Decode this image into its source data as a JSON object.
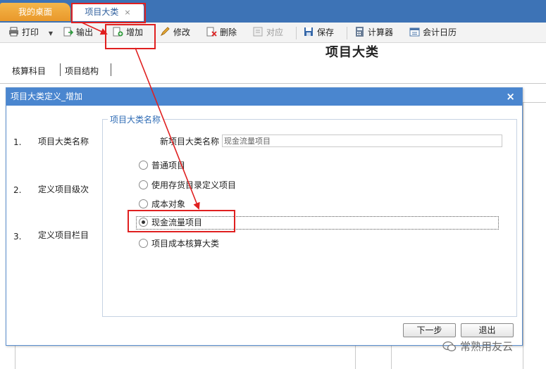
{
  "tabs": {
    "home": "我的桌面",
    "active": "项目大类",
    "close": "×"
  },
  "toolbar": {
    "print": "打印",
    "export": "输出",
    "add": "增加",
    "edit": "修改",
    "delete": "删除",
    "match": "对应",
    "save": "保存",
    "calculator": "计算器",
    "calendar": "会计日历"
  },
  "page": {
    "title": "项目大类",
    "nav": [
      "核算科目",
      "项目结构"
    ]
  },
  "dialog": {
    "title": "项目大类定义_增加",
    "close": "×",
    "steps": [
      {
        "num": "1.",
        "label": "项目大类名称"
      },
      {
        "num": "2.",
        "label": "定义项目级次"
      },
      {
        "num": "3.",
        "label": "定义项目栏目"
      }
    ],
    "group_title": "项目大类名称",
    "name_label": "新项目大类名称",
    "name_value": "现金流量项目",
    "options": [
      "普通项目",
      "使用存货目录定义项目",
      "成本对象",
      "现金流量项目",
      "项目成本核算大类"
    ],
    "selected_option": "现金流量项目",
    "next_button": "下一步",
    "exit_button": "退出"
  },
  "watermark": "常熟用友云"
}
